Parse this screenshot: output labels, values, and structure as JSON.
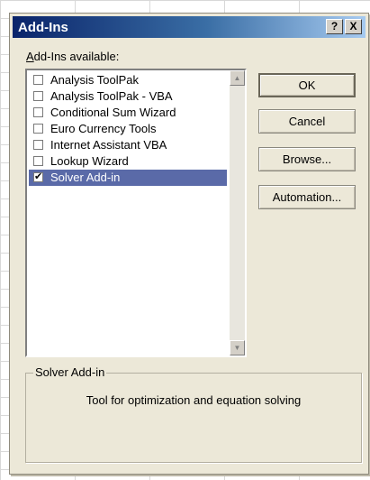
{
  "dialog": {
    "title": "Add-Ins",
    "help_button": "?",
    "close_button": "X"
  },
  "list": {
    "label_prefix": "",
    "label_mnemonic": "A",
    "label_rest": "dd-Ins available:",
    "items": [
      {
        "label": "Analysis ToolPak",
        "checked": false,
        "selected": false
      },
      {
        "label": "Analysis ToolPak - VBA",
        "checked": false,
        "selected": false
      },
      {
        "label": "Conditional Sum Wizard",
        "checked": false,
        "selected": false
      },
      {
        "label": "Euro Currency Tools",
        "checked": false,
        "selected": false
      },
      {
        "label": "Internet Assistant VBA",
        "checked": false,
        "selected": false
      },
      {
        "label": "Lookup Wizard",
        "checked": false,
        "selected": false
      },
      {
        "label": "Solver Add-in",
        "checked": true,
        "selected": true
      }
    ]
  },
  "buttons": {
    "ok": "OK",
    "cancel": "Cancel",
    "browse": "Browse...",
    "automation": "Automation..."
  },
  "details": {
    "legend": "Solver Add-in",
    "description": "Tool for optimization and equation solving"
  },
  "colors": {
    "selection": "#5a6aa8",
    "dialog_face": "#ece8d8"
  }
}
